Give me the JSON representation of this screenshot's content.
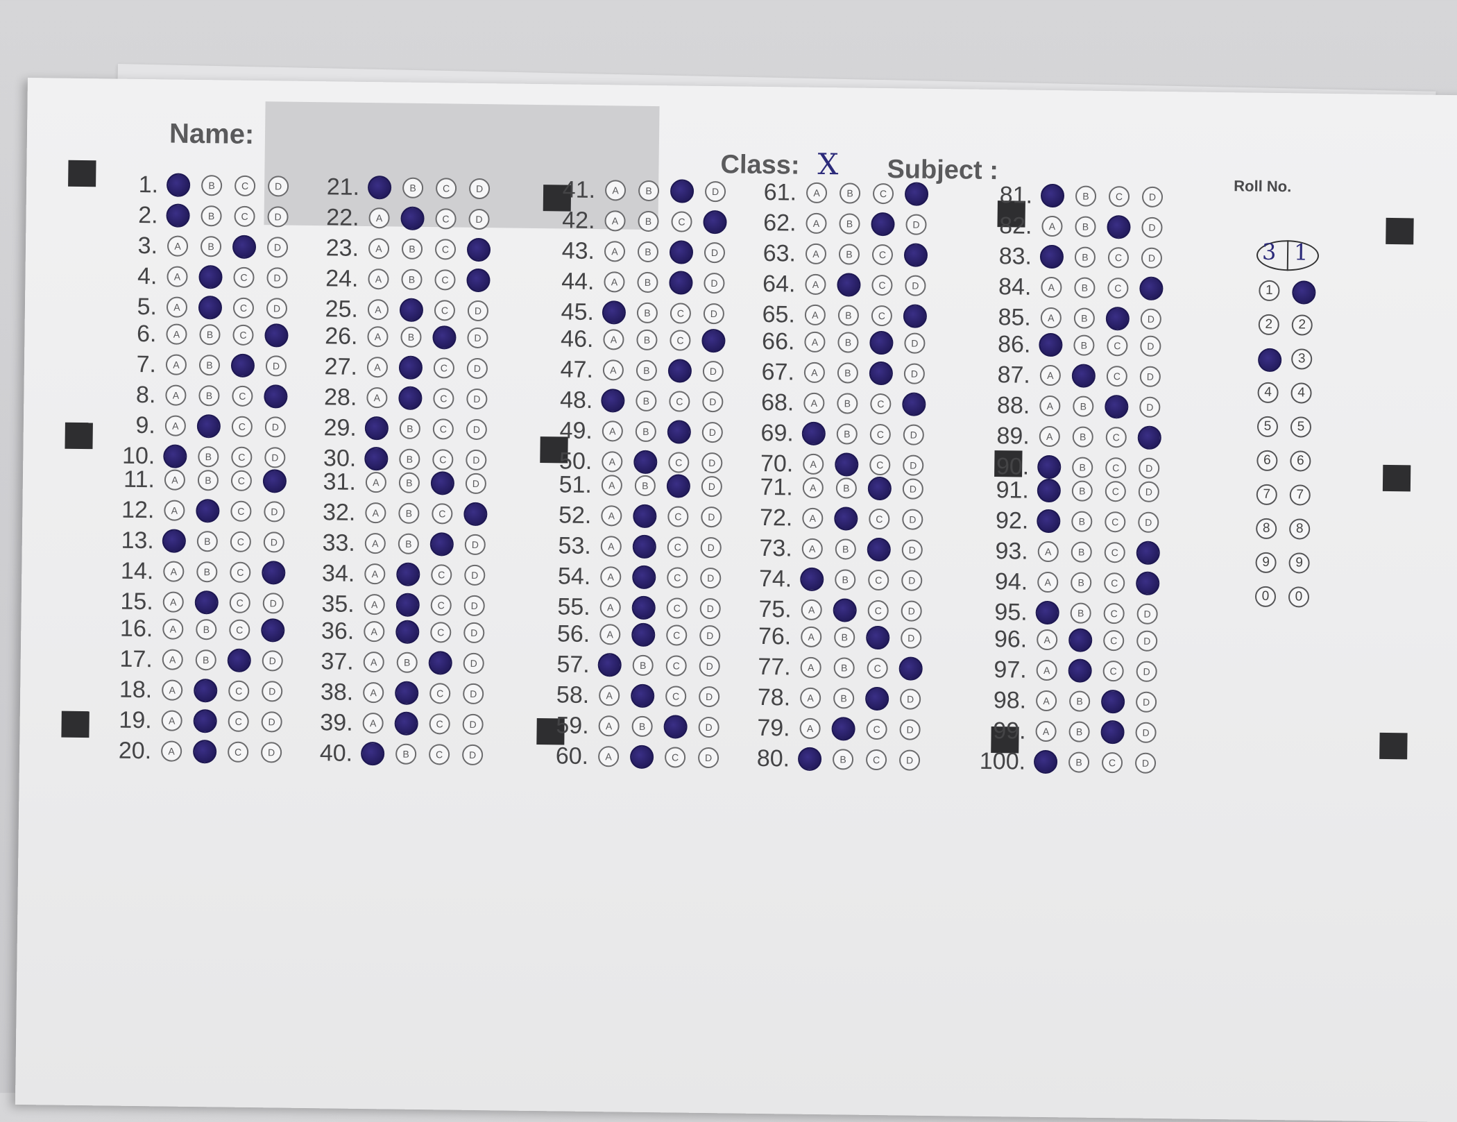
{
  "header": {
    "name_label": "Name:",
    "class_label": "Class:",
    "class_value": "X",
    "subject_label": "Subject :",
    "roll_label": "Roll No.",
    "roll_value": [
      "3",
      "1"
    ]
  },
  "options": [
    "A",
    "B",
    "C",
    "D"
  ],
  "roll_digits": [
    "1",
    "2",
    "3",
    "4",
    "5",
    "6",
    "7",
    "8",
    "9",
    "0"
  ],
  "roll_filled": [
    2,
    0
  ],
  "answers": [
    "A",
    "A",
    "C",
    "B",
    "B",
    "D",
    "C",
    "D",
    "B",
    "A",
    "D",
    "B",
    "A",
    "D",
    "B",
    "D",
    "C",
    "B",
    "B",
    "B",
    "A",
    "B",
    "D",
    "D",
    "B",
    "C",
    "B",
    "B",
    "A",
    "A",
    "C",
    "D",
    "C",
    "B",
    "B",
    "B",
    "C",
    "B",
    "B",
    "A",
    "C",
    "D",
    "C",
    "C",
    "A",
    "D",
    "C",
    "A",
    "C",
    "B",
    "C",
    "B",
    "B",
    "B",
    "B",
    "B",
    "A",
    "B",
    "C",
    "B",
    "D",
    "C",
    "D",
    "B",
    "D",
    "C",
    "C",
    "D",
    "A",
    "B",
    "C",
    "B",
    "C",
    "A",
    "B",
    "C",
    "D",
    "C",
    "B",
    "A",
    "A",
    "C",
    "A",
    "D",
    "C",
    "A",
    "B",
    "C",
    "D",
    "A",
    "A",
    "A",
    "D",
    "D",
    "A",
    "B",
    "B",
    "C",
    "C",
    "A"
  ],
  "colors": {
    "ink": "#241c5e",
    "paper": "#eeeeef",
    "marker": "#2e2e30"
  }
}
